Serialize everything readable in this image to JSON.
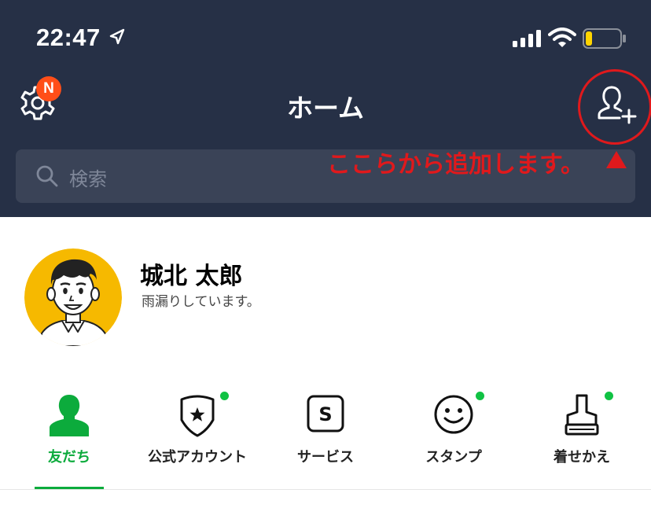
{
  "status_bar": {
    "time": "22:47"
  },
  "header": {
    "title": "ホーム",
    "settings_badge": "N"
  },
  "annotation": {
    "text": "ここらから追加します。"
  },
  "search": {
    "placeholder": "検索"
  },
  "profile": {
    "name": "城北 太郎",
    "status": "雨漏りしています。"
  },
  "tabs": [
    {
      "label": "友だち",
      "icon": "person-icon",
      "active": true,
      "dot": false
    },
    {
      "label": "公式アカウント",
      "icon": "shield-star-icon",
      "active": false,
      "dot": true
    },
    {
      "label": "サービス",
      "icon": "service-s-icon",
      "active": false,
      "dot": false
    },
    {
      "label": "スタンプ",
      "icon": "smiley-icon",
      "active": false,
      "dot": true
    },
    {
      "label": "着せかえ",
      "icon": "brush-icon",
      "active": false,
      "dot": true
    }
  ],
  "colors": {
    "header_bg": "#263046",
    "accent": "#0cab3c",
    "badge": "#ff4e18",
    "annotation": "#e0191c"
  }
}
